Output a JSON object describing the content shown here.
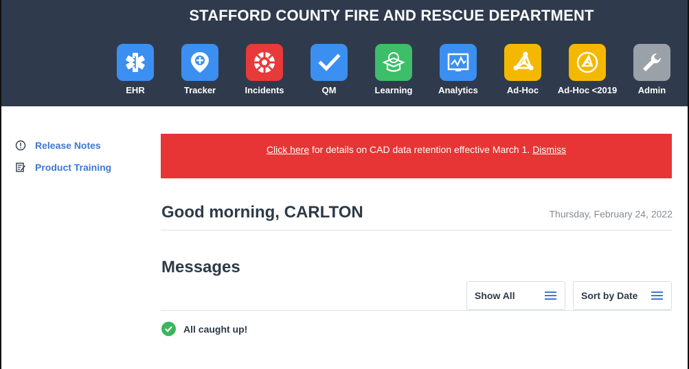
{
  "header": {
    "org_title": "STAFFORD COUNTY FIRE AND RESCUE DEPARTMENT",
    "apps": [
      {
        "label": "EHR",
        "icon": "star-of-life-icon",
        "color": "#3b8ff0"
      },
      {
        "label": "Tracker",
        "icon": "location-pin-icon",
        "color": "#3b8ff0"
      },
      {
        "label": "Incidents",
        "icon": "fire-badge-icon",
        "color": "#e83a3a"
      },
      {
        "label": "QM",
        "icon": "checkmark-icon",
        "color": "#3b8ff0"
      },
      {
        "label": "Learning",
        "icon": "graduation-cap-icon",
        "color": "#3cbf68"
      },
      {
        "label": "Analytics",
        "icon": "line-chart-icon",
        "color": "#3b8ff0"
      },
      {
        "label": "Ad-Hoc",
        "icon": "network-nodes-icon",
        "color": "#f5b800"
      },
      {
        "label": "Ad-Hoc <2019",
        "icon": "network-circle-icon",
        "color": "#f5b800"
      },
      {
        "label": "Admin",
        "icon": "wrench-icon",
        "color": "#9aa1a9"
      }
    ]
  },
  "sidebar": {
    "items": [
      {
        "label": "Release Notes",
        "icon": "exclamation-circle-icon"
      },
      {
        "label": "Product Training",
        "icon": "notepad-edit-icon"
      }
    ]
  },
  "alert": {
    "link_text": "Click here",
    "message": " for details on CAD data retention effective March 1. ",
    "dismiss_text": "Dismiss",
    "color": "#e73434"
  },
  "greeting": "Good morning, CARLTON",
  "date": "Thursday, February 24, 2022",
  "messages": {
    "title": "Messages",
    "show_filter": "Show All",
    "sort_filter": "Sort by Date",
    "empty_text": "All caught up!"
  }
}
